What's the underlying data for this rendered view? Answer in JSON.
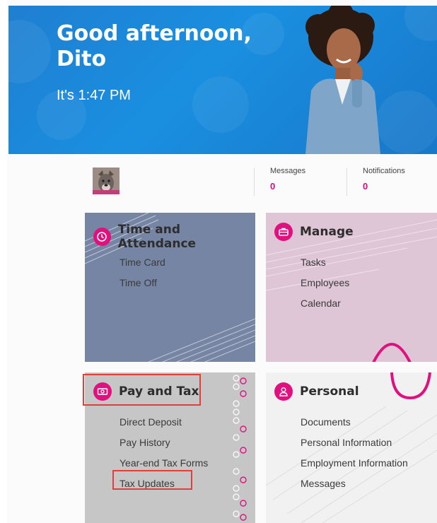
{
  "banner": {
    "greeting_line1": "Good afternoon,",
    "greeting_line2": "Dito",
    "time": "It's 1:47 PM"
  },
  "profile": {
    "messages_label": "Messages",
    "messages_count": "0",
    "notifications_label": "Notifications",
    "notifications_count": "0"
  },
  "tiles": {
    "time_attendance": {
      "title": "Time and Attendance",
      "icon": "clock-icon",
      "links": [
        "Time Card",
        "Time Off"
      ]
    },
    "manage": {
      "title": "Manage",
      "icon": "briefcase-icon",
      "links": [
        "Tasks",
        "Employees",
        "Calendar"
      ]
    },
    "pay_tax": {
      "title": "Pay and Tax",
      "icon": "money-icon",
      "links": [
        "Direct Deposit",
        "Pay History",
        "Year-end Tax Forms",
        "Tax Updates"
      ]
    },
    "personal": {
      "title": "Personal",
      "icon": "person-icon",
      "links": [
        "Documents",
        "Personal Information",
        "Employment Information",
        "Messages"
      ]
    }
  },
  "colors": {
    "accent": "#e0117f",
    "banner_blue": "#1a8fe0",
    "highlight_red": "#e0403a"
  }
}
